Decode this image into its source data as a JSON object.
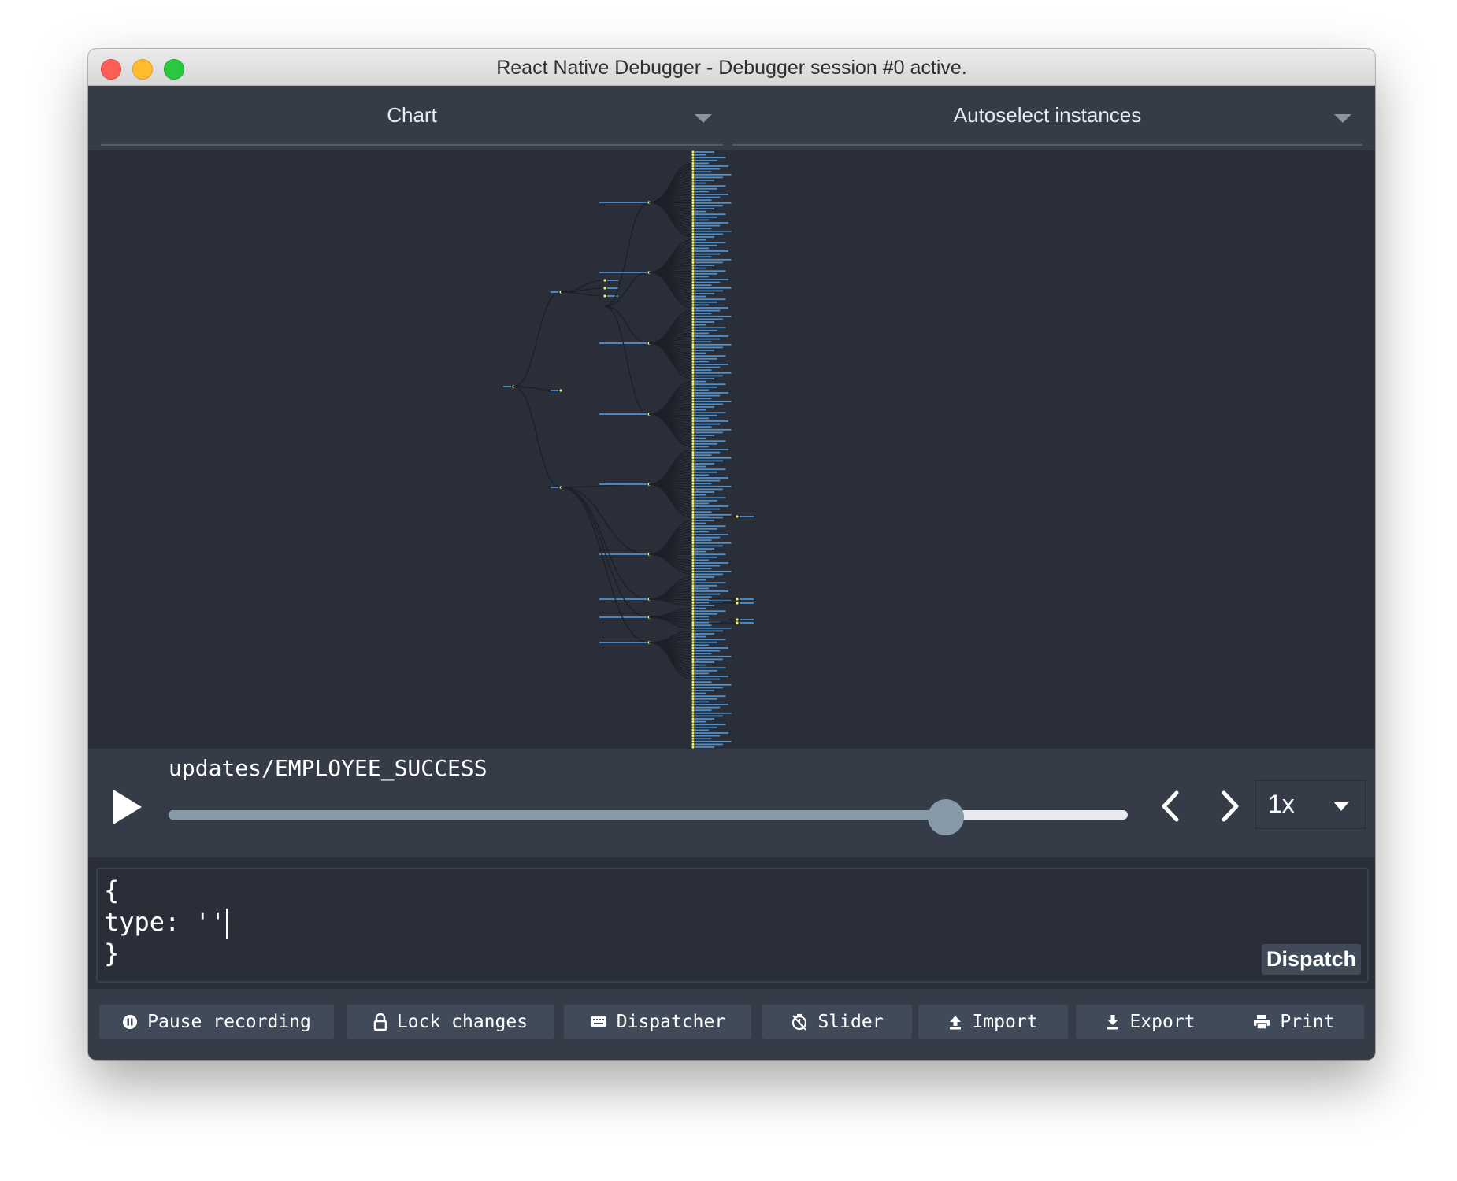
{
  "window": {
    "title": "React Native Debugger - Debugger session #0 active."
  },
  "monitor_select": {
    "value": "Chart"
  },
  "instance_select": {
    "value": "Autoselect instances"
  },
  "slider": {
    "action": "updates/EMPLOYEE_SUCCESS",
    "progress": 0.81,
    "speed": "1x"
  },
  "dispatcher": {
    "lines": [
      "{",
      "type: ''",
      "}"
    ],
    "button": "Dispatch"
  },
  "toolbar": {
    "pause": "Pause recording",
    "lock": "Lock changes",
    "dispatcher": "Dispatcher",
    "slider": "Slider",
    "import": "Import",
    "export": "Export",
    "print": "Print"
  },
  "colors": {
    "background": "#2a2e38",
    "panel": "#353b47",
    "button": "#414a58",
    "tree_link": "#1d2028",
    "tree_node": "#e7f35a",
    "tree_label": "#5cb3ff"
  }
}
